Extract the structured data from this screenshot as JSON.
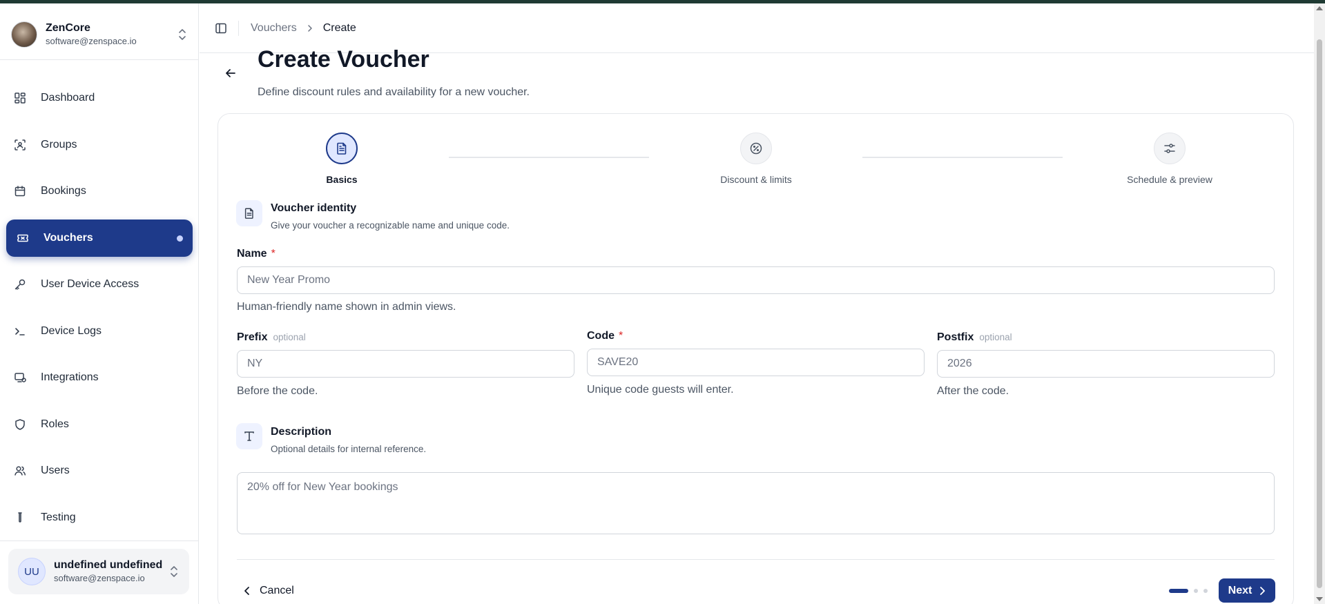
{
  "org": {
    "name": "ZenCore",
    "email": "software@zenspace.io"
  },
  "sidebar": {
    "items": [
      {
        "label": "Dashboard",
        "icon": "dashboard-icon"
      },
      {
        "label": "Groups",
        "icon": "groups-icon"
      },
      {
        "label": "Bookings",
        "icon": "calendar-icon"
      },
      {
        "label": "Vouchers",
        "icon": "ticket-icon",
        "active": true
      },
      {
        "label": "User Device Access",
        "icon": "key-icon"
      },
      {
        "label": "Device Logs",
        "icon": "terminal-icon"
      },
      {
        "label": "Integrations",
        "icon": "integrations-icon"
      },
      {
        "label": "Roles",
        "icon": "shield-icon"
      },
      {
        "label": "Users",
        "icon": "users-icon"
      },
      {
        "label": "Testing",
        "icon": "test-tube-icon"
      }
    ]
  },
  "user": {
    "initials": "UU",
    "name": "undefined undefined",
    "email": "software@zenspace.io"
  },
  "breadcrumb": {
    "parent": "Vouchers",
    "current": "Create"
  },
  "page": {
    "title": "Create Voucher",
    "subtitle": "Define discount rules and availability for a new voucher."
  },
  "steps": [
    {
      "label": "Basics",
      "icon": "document-icon",
      "active": true
    },
    {
      "label": "Discount & limits",
      "icon": "percent-badge-icon",
      "active": false
    },
    {
      "label": "Schedule & preview",
      "icon": "sliders-icon",
      "active": false
    }
  ],
  "identity": {
    "title": "Voucher identity",
    "desc": "Give your voucher a recognizable name and unique code."
  },
  "fields": {
    "name": {
      "label": "Name",
      "required": "*",
      "placeholder": "New Year Promo",
      "help": "Human-friendly name shown in admin views."
    },
    "prefix": {
      "label": "Prefix",
      "optional": "optional",
      "placeholder": "NY",
      "help": "Before the code."
    },
    "code": {
      "label": "Code",
      "required": "*",
      "placeholder": "SAVE20",
      "help": "Unique code guests will enter."
    },
    "postfix": {
      "label": "Postfix",
      "optional": "optional",
      "placeholder": "2026",
      "help": "After the code."
    }
  },
  "description": {
    "title": "Description",
    "desc": "Optional details for internal reference.",
    "placeholder": "20% off for New Year bookings"
  },
  "footer": {
    "cancel": "Cancel",
    "next": "Next",
    "current_step": 1,
    "total_steps": 3
  },
  "colors": {
    "accent": "#1e3a8a",
    "required": "#dc2626"
  }
}
